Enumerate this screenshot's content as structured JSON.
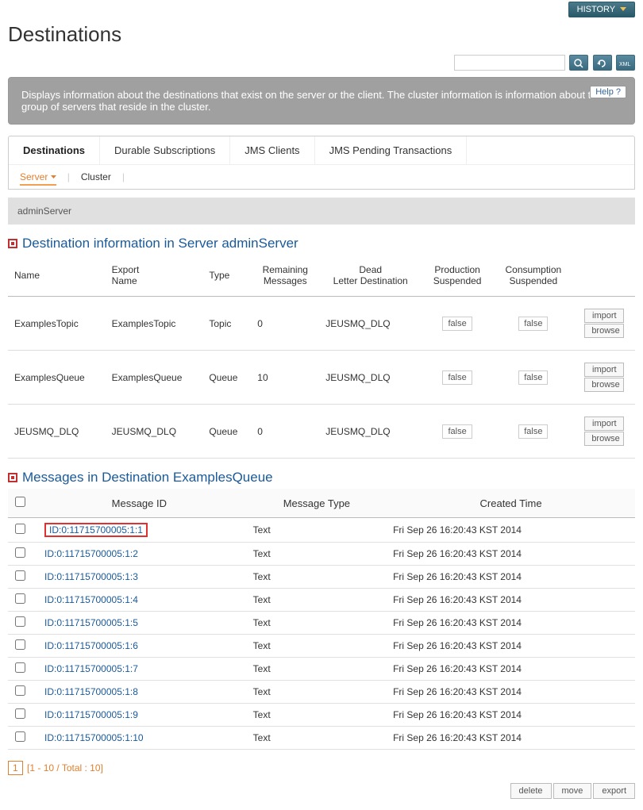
{
  "history_label": "HISTORY",
  "page_title": "Destinations",
  "search_placeholder": "",
  "description": "Displays information about the destinations that exist on the server or the client. The cluster information is information about the group of servers that reside in the cluster.",
  "help_label": "Help",
  "tabs": [
    "Destinations",
    "Durable Subscriptions",
    "JMS Clients",
    "JMS Pending Transactions"
  ],
  "subtabs": [
    "Server",
    "Cluster"
  ],
  "server_name": "adminServer",
  "dest_section_title": "Destination information in Server adminServer",
  "dest_headers": [
    "Name",
    "Export Name",
    "Type",
    "Remaining Messages",
    "Dead Letter Destination",
    "Production Suspended",
    "Consumption Suspended",
    ""
  ],
  "dest_rows": [
    {
      "name": "ExamplesTopic",
      "export": "ExamplesTopic",
      "type": "Topic",
      "remaining": "0",
      "dld": "JEUSMQ_DLQ",
      "prod": "false",
      "cons": "false"
    },
    {
      "name": "ExamplesQueue",
      "export": "ExamplesQueue",
      "type": "Queue",
      "remaining": "10",
      "dld": "JEUSMQ_DLQ",
      "prod": "false",
      "cons": "false"
    },
    {
      "name": "JEUSMQ_DLQ",
      "export": "JEUSMQ_DLQ",
      "type": "Queue",
      "remaining": "0",
      "dld": "JEUSMQ_DLQ",
      "prod": "false",
      "cons": "false"
    }
  ],
  "row_actions": {
    "import": "import",
    "browse": "browse"
  },
  "msgs_section_title": "Messages in Destination ExamplesQueue",
  "msgs_headers": [
    "",
    "Message ID",
    "Message Type",
    "Created Time"
  ],
  "msgs_rows": [
    {
      "id": "ID:0:11715700005:1:1",
      "type": "Text",
      "created": "Fri Sep 26 16:20:43 KST 2014",
      "hl": true
    },
    {
      "id": "ID:0:11715700005:1:2",
      "type": "Text",
      "created": "Fri Sep 26 16:20:43 KST 2014"
    },
    {
      "id": "ID:0:11715700005:1:3",
      "type": "Text",
      "created": "Fri Sep 26 16:20:43 KST 2014"
    },
    {
      "id": "ID:0:11715700005:1:4",
      "type": "Text",
      "created": "Fri Sep 26 16:20:43 KST 2014"
    },
    {
      "id": "ID:0:11715700005:1:5",
      "type": "Text",
      "created": "Fri Sep 26 16:20:43 KST 2014"
    },
    {
      "id": "ID:0:11715700005:1:6",
      "type": "Text",
      "created": "Fri Sep 26 16:20:43 KST 2014"
    },
    {
      "id": "ID:0:11715700005:1:7",
      "type": "Text",
      "created": "Fri Sep 26 16:20:43 KST 2014"
    },
    {
      "id": "ID:0:11715700005:1:8",
      "type": "Text",
      "created": "Fri Sep 26 16:20:43 KST 2014"
    },
    {
      "id": "ID:0:11715700005:1:9",
      "type": "Text",
      "created": "Fri Sep 26 16:20:43 KST 2014"
    },
    {
      "id": "ID:0:11715700005:1:10",
      "type": "Text",
      "created": "Fri Sep 26 16:20:43 KST 2014"
    }
  ],
  "pager": {
    "current": "1",
    "text": "[1 - 10 / Total : 10]"
  },
  "footer_buttons": [
    "delete",
    "move",
    "export"
  ]
}
